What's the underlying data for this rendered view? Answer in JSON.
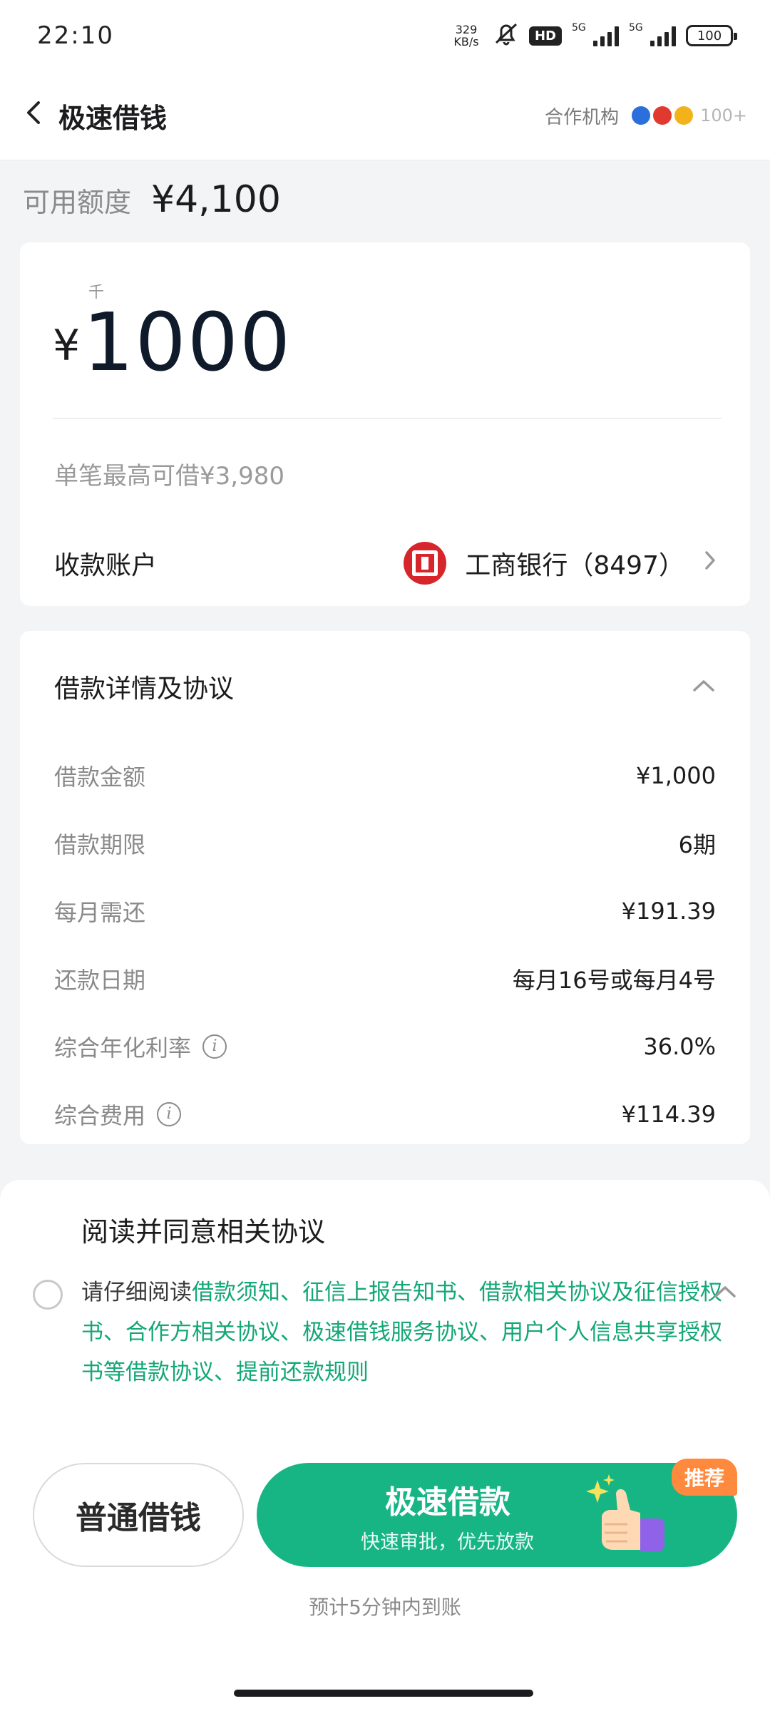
{
  "status_bar": {
    "time": "22:10",
    "net_speed_value": "329",
    "net_speed_unit": "KB/s",
    "hd_label": "HD",
    "signal1_label": "5G",
    "signal2_label": "5G",
    "battery": "100"
  },
  "nav": {
    "title": "极速借钱",
    "partner_label": "合作机构",
    "partner_count": "100+"
  },
  "available_credit": {
    "label": "可用额度",
    "value": "¥4,100"
  },
  "amount_card": {
    "unit_hint": "千",
    "currency": "¥",
    "amount": "1000",
    "max_borrow": "单笔最高可借¥3,980",
    "account_label": "收款账户",
    "bank_name": "工商银行（8497）"
  },
  "details": {
    "title": "借款详情及协议",
    "rows": [
      {
        "label": "借款金额",
        "value": "¥1,000"
      },
      {
        "label": "借款期限",
        "value": "6期"
      },
      {
        "label": "每月需还",
        "value": "¥191.39"
      },
      {
        "label": "还款日期",
        "value": "每月16号或每月4号"
      },
      {
        "label": "综合年化利率",
        "value": "36.0%"
      },
      {
        "label": "综合费用",
        "value": "¥114.39"
      }
    ]
  },
  "agreement": {
    "title": "阅读并同意相关协议",
    "prefix": "请仔细阅读",
    "links": "借款须知、征信上报告知书、借款相关协议及征信授权书、合作方相关协议、极速借钱服务协议、用户个人信息共享授权书等借款协议、提前还款规则"
  },
  "actions": {
    "normal_label": "普通借钱",
    "fast_label": "极速借款",
    "fast_sub": "快速审批，优先放款",
    "badge": "推荐",
    "arrival_note": "预计5分钟内到账"
  },
  "colors": {
    "accent": "#17b584",
    "link": "#14a777",
    "badge": "#ff8a3d",
    "bank_red": "#d7262b"
  }
}
